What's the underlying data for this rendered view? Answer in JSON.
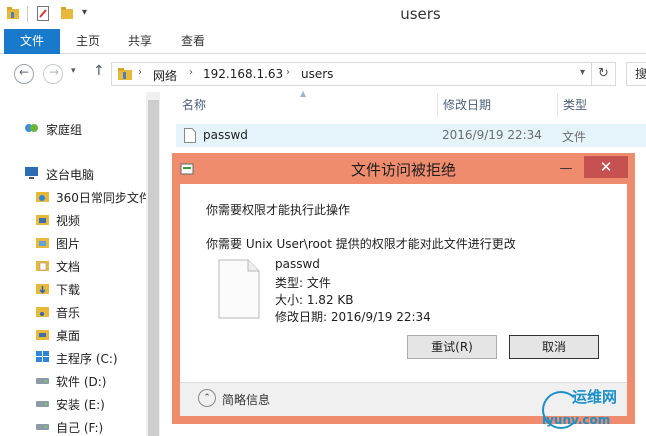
{
  "window": {
    "title": "users"
  },
  "ribbon": {
    "tabs": [
      "文件",
      "主页",
      "共享",
      "查看"
    ]
  },
  "address": {
    "crumbs": [
      "网络",
      "192.168.1.63",
      "users"
    ],
    "search_label": "搜"
  },
  "sidebar": {
    "items": [
      {
        "label": "家庭组",
        "icon": "homegroup-icon"
      },
      {
        "label": "这台电脑",
        "icon": "computer-icon"
      },
      {
        "label": "360日常同步文件",
        "icon": "sync-folder-icon"
      },
      {
        "label": "视频",
        "icon": "videos-folder-icon"
      },
      {
        "label": "图片",
        "icon": "pictures-folder-icon"
      },
      {
        "label": "文档",
        "icon": "documents-folder-icon"
      },
      {
        "label": "下载",
        "icon": "downloads-folder-icon"
      },
      {
        "label": "音乐",
        "icon": "music-folder-icon"
      },
      {
        "label": "桌面",
        "icon": "desktop-folder-icon"
      },
      {
        "label": "主程序 (C:)",
        "icon": "windows-drive-icon"
      },
      {
        "label": "软件 (D:)",
        "icon": "drive-icon"
      },
      {
        "label": "安装 (E:)",
        "icon": "drive-icon"
      },
      {
        "label": "自己 (F:)",
        "icon": "drive-icon"
      }
    ]
  },
  "filelist": {
    "columns": [
      "名称",
      "修改日期",
      "类型"
    ],
    "rows": [
      {
        "name": "passwd",
        "date": "2016/9/19 22:34",
        "type": "文件"
      }
    ]
  },
  "dialog": {
    "title": "文件访问被拒绝",
    "message1": "你需要权限才能执行此操作",
    "message2": "你需要 Unix User\\root 提供的权限才能对此文件进行更改",
    "file_name": "passwd",
    "file_type": "类型: 文件",
    "file_size": "大小: 1.82 KB",
    "file_modified": "修改日期: 2016/9/19 22:34",
    "retry_label": "重试(R)",
    "cancel_label": "取消",
    "details_label": "简略信息",
    "close_glyph": "✕",
    "min_glyph": "—"
  },
  "watermark": {
    "line1": "运维网",
    "line2": "iyunv.com"
  },
  "colors": {
    "accent": "#1979ca",
    "dialog_frame": "#ef8c6d",
    "close": "#c75050",
    "selection": "#e5f3fb"
  }
}
